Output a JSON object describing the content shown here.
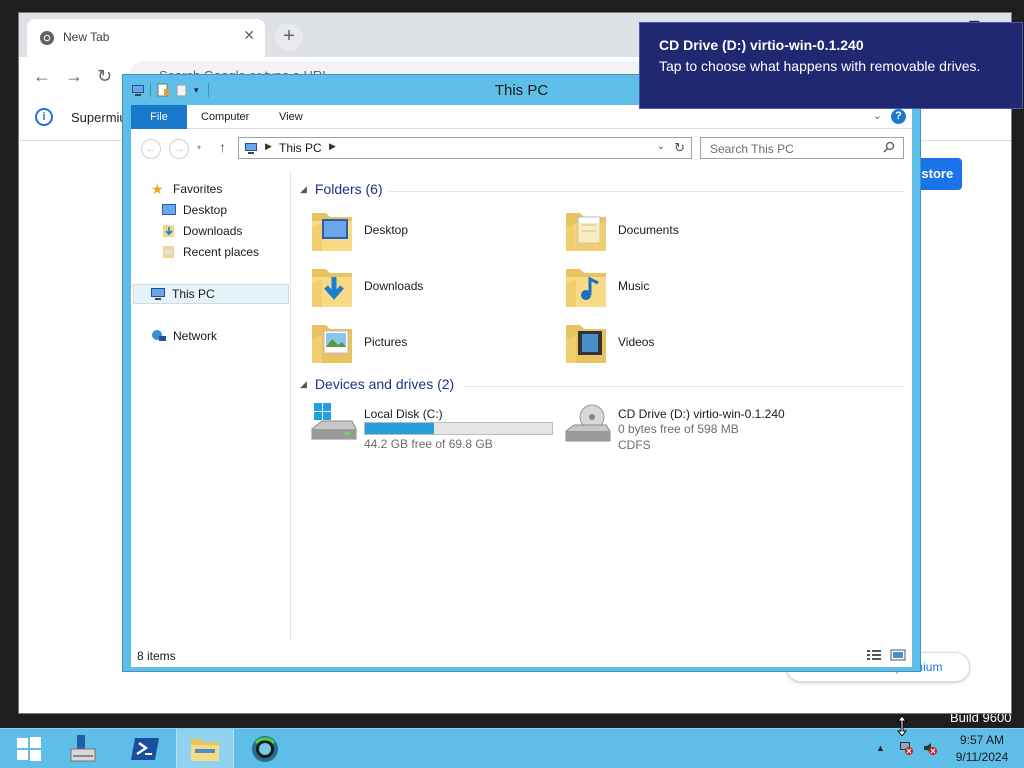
{
  "browser": {
    "tab_title": "New Tab",
    "omnibox_placeholder": "Search Google or type a URL",
    "infobar_text": "Supermium",
    "restore_label": "Restore",
    "customise_label": "Customise Supermium"
  },
  "explorer": {
    "title": "This PC",
    "ribbon_tabs": [
      "File",
      "Computer",
      "View"
    ],
    "address_path": "This PC",
    "search_placeholder": "Search This PC",
    "nav": {
      "favorites": "Favorites",
      "desktop": "Desktop",
      "downloads": "Downloads",
      "recent": "Recent places",
      "this_pc": "This PC",
      "network": "Network"
    },
    "folders_header": "Folders (6)",
    "folders": [
      "Desktop",
      "Documents",
      "Downloads",
      "Music",
      "Pictures",
      "Videos"
    ],
    "drives_header": "Devices and drives (2)",
    "drives": [
      {
        "name": "Local Disk (C:)",
        "free": "44.2 GB free of 69.8 GB",
        "used_fraction": 0.367
      },
      {
        "name": "CD Drive (D:) virtio-win-0.1.240",
        "free": "0 bytes free of 598 MB",
        "fs": "CDFS"
      }
    ],
    "status": "8 items"
  },
  "toast": {
    "title": "CD Drive (D:) virtio-win-0.1.240",
    "body": "Tap to choose what happens with removable drives."
  },
  "taskbar": {
    "time": "9:57 AM",
    "date": "9/11/2024"
  },
  "desktop": {
    "build_text": "Build 9600"
  },
  "colors": {
    "window_frame": "#5ebee7",
    "ribbon_file": "#1979ca",
    "toast_bg": "#1f2870",
    "drive_fill": "#26a0da"
  }
}
